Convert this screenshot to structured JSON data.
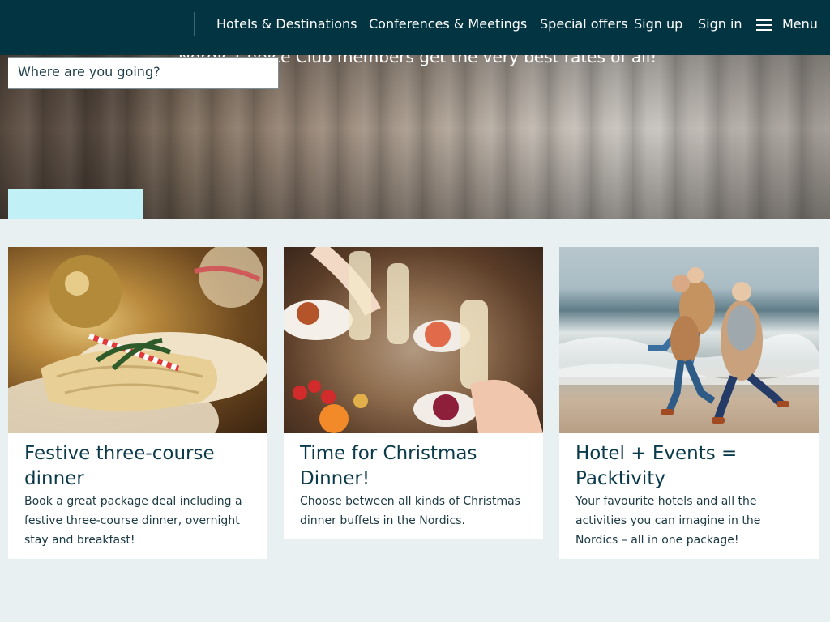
{
  "header": {
    "nav": [
      {
        "label": "Hotels & Destinations"
      },
      {
        "label": "Conferences & Meetings"
      },
      {
        "label": "Special offers"
      },
      {
        "label": "Sign up"
      },
      {
        "label": "Sign in"
      }
    ],
    "menu_label": "Menu"
  },
  "hero": {
    "text": "Nordic Choice Club members get the very best rates of all!",
    "search_placeholder": "Where are you going?",
    "button_label": ""
  },
  "cards": [
    {
      "title": "Festive three-course dinner",
      "description": "Book a great package deal including a festive three-course dinner, overnight stay and breakfast!"
    },
    {
      "title": "Time for Christmas Dinner!",
      "description": "Choose between all kinds of Christmas dinner buffets in the Nordics."
    },
    {
      "title": "Hotel + Events = Packtivity",
      "description": "Your favourite hotels and all the activities you can imagine in the Nordics – all in one package!"
    }
  ],
  "colors": {
    "header_bg": "#033442",
    "page_bg": "#e9f0f2",
    "accent_button": "#c2f0f7",
    "heading_text": "#0b3b4b"
  },
  "icons": {
    "menu": "hamburger-icon"
  }
}
